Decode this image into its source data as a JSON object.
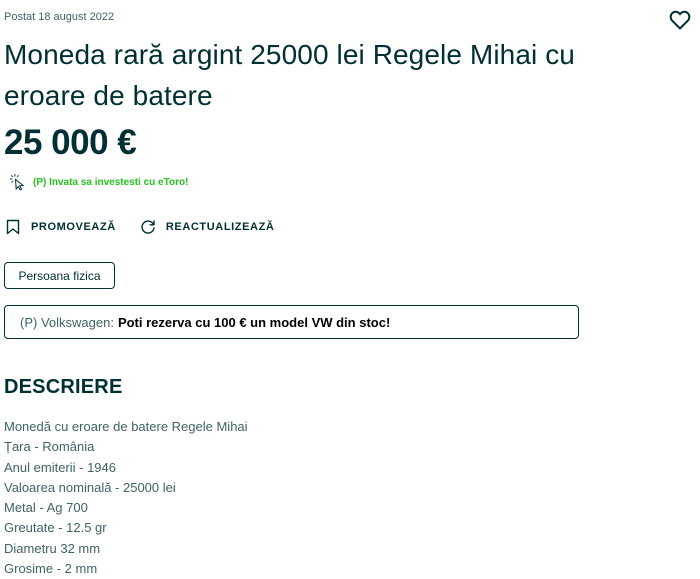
{
  "listing": {
    "posted": "Postat 18 august 2022",
    "favorite_icon": "heart-icon",
    "title": "Moneda rară argint 25000 lei Regele Mihai cu eroare de batere",
    "price": "25 000 €"
  },
  "sponsored": {
    "icon": "click-cursor-icon",
    "text": "(P) Invata sa investesti cu eToro!",
    "color": "#23c41f"
  },
  "actions": {
    "promote": {
      "label": "PROMOVEAZĂ",
      "icon": "bookmark-icon"
    },
    "refresh": {
      "label": "REACTUALIZEAZĂ",
      "icon": "refresh-icon"
    }
  },
  "seller_type": "Persoana fizica",
  "banner": {
    "prefix": "(P) Volkswagen:",
    "text": "Poti rezerva cu 100 € un model VW din stoc!"
  },
  "description": {
    "heading": "DESCRIERE",
    "lines": [
      "Monedă cu eroare de batere Regele Mihai",
      "Țara - România",
      "Anul emiterii - 1946",
      "Valoarea nominală - 25000 lei",
      "Metal - Ag 700",
      "Greutate - 12.5 gr",
      "Diametru 32 mm",
      "Grosime - 2 mm"
    ]
  },
  "colors": {
    "text_primary": "#002f34",
    "text_secondary": "#406367",
    "accent_green": "#23c41f"
  }
}
